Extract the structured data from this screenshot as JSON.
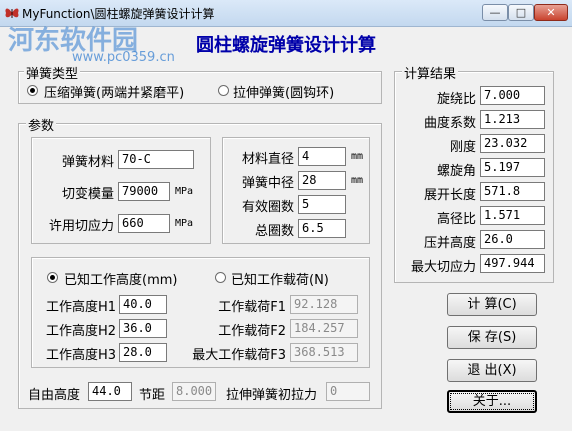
{
  "window": {
    "title": "MyFunction\\圆柱螺旋弹簧设计计算",
    "minimize_glyph": "—",
    "maximize_glyph": "□",
    "close_glyph": "✕"
  },
  "watermark": {
    "logo": "河东软件园",
    "url": "www.pc0359.cn"
  },
  "heading": "圆柱螺旋弹簧设计计算",
  "spring_type": {
    "label": "弹簧类型",
    "options": [
      "压缩弹簧(两端并紧磨平)",
      "拉伸弹簧(圆钩环)"
    ],
    "selected_index": 0
  },
  "params": {
    "label": "参数",
    "material_label": "弹簧材料",
    "material_value": "70-C",
    "shear_modulus_label": "切变模量",
    "shear_modulus_value": "79000",
    "shear_modulus_unit": "MPa",
    "allow_stress_label": "许用切应力",
    "allow_stress_value": "660",
    "allow_stress_unit": "MPa",
    "wire_dia_label": "材料直径",
    "wire_dia_value": "4",
    "wire_dia_unit": "mm",
    "mean_dia_label": "弹簧中径",
    "mean_dia_value": "28",
    "mean_dia_unit": "mm",
    "active_coils_label": "有效圈数",
    "active_coils_value": "5",
    "total_coils_label": "总圈数",
    "total_coils_value": "6.5"
  },
  "work_mode": {
    "options": [
      "已知工作高度(mm)",
      "已知工作载荷(N)"
    ],
    "selected_index": 0,
    "h1_label": "工作高度H1",
    "h1_value": "40.0",
    "h2_label": "工作高度H2",
    "h2_value": "36.0",
    "h3_label": "工作高度H3",
    "h3_value": "28.0",
    "f1_label": "工作载荷F1",
    "f1_value": "92.128",
    "f2_label": "工作载荷F2",
    "f2_value": "184.257",
    "f3_label": "最大工作载荷F3",
    "f3_value": "368.513"
  },
  "bottom": {
    "free_height_label": "自由高度",
    "free_height_value": "44.0",
    "pitch_label": "节距",
    "pitch_value": "8.000",
    "init_tension_label": "拉伸弹簧初拉力",
    "init_tension_value": "0"
  },
  "results": {
    "label": "计算结果",
    "rows": [
      {
        "label": "旋绕比",
        "value": "7.000"
      },
      {
        "label": "曲度系数",
        "value": "1.213"
      },
      {
        "label": "刚度",
        "value": "23.032"
      },
      {
        "label": "螺旋角",
        "value": "5.197"
      },
      {
        "label": "展开长度",
        "value": "571.8"
      },
      {
        "label": "高径比",
        "value": "1.571"
      },
      {
        "label": "压并高度",
        "value": "26.0"
      },
      {
        "label": "最大切应力",
        "value": "497.944"
      }
    ]
  },
  "buttons": {
    "calc": "计 算(C)",
    "save": "保 存(S)",
    "exit": "退 出(X)",
    "about": "关于..."
  }
}
